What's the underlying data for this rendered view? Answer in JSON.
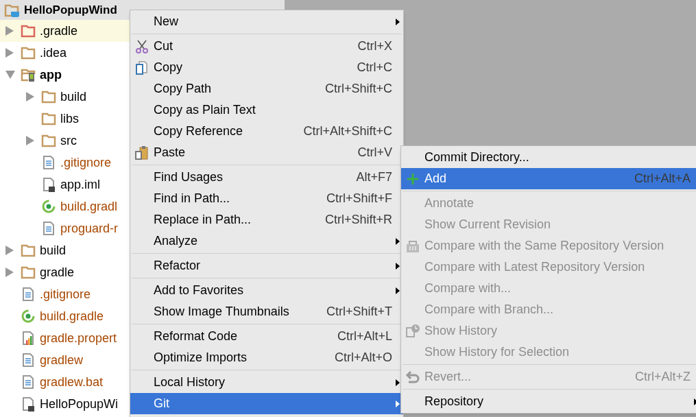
{
  "project_header": {
    "name": "HelloPopupWind"
  },
  "tree": [
    {
      "label": ".gradle",
      "kind": "excluded-folder",
      "expanded": false,
      "highlighted": true,
      "changed": false,
      "bold": false
    },
    {
      "label": ".idea",
      "kind": "folder",
      "expanded": false,
      "highlighted": false,
      "changed": false,
      "bold": false
    },
    {
      "label": "app",
      "kind": "module",
      "expanded": true,
      "highlighted": false,
      "changed": false,
      "bold": true,
      "children": [
        {
          "label": "build",
          "kind": "folder",
          "expanded": false,
          "highlighted": false,
          "changed": false,
          "bold": false
        },
        {
          "label": "libs",
          "kind": "folder",
          "highlighted": false,
          "changed": false,
          "bold": false
        },
        {
          "label": "src",
          "kind": "folder",
          "expanded": false,
          "highlighted": false,
          "changed": false,
          "bold": false
        },
        {
          "label": ".gitignore",
          "kind": "text",
          "highlighted": false,
          "changed": true,
          "bold": false
        },
        {
          "label": "app.iml",
          "kind": "iml",
          "highlighted": false,
          "changed": false,
          "bold": false
        },
        {
          "label": "build.gradl",
          "kind": "gradle",
          "highlighted": false,
          "changed": true,
          "bold": false
        },
        {
          "label": "proguard-r",
          "kind": "text",
          "highlighted": false,
          "changed": true,
          "bold": false
        }
      ]
    },
    {
      "label": "build",
      "kind": "folder",
      "expanded": false,
      "highlighted": false,
      "changed": false,
      "bold": false
    },
    {
      "label": "gradle",
      "kind": "folder",
      "expanded": false,
      "highlighted": false,
      "changed": false,
      "bold": false
    },
    {
      "label": ".gitignore",
      "kind": "text",
      "highlighted": false,
      "changed": true,
      "bold": false
    },
    {
      "label": "build.gradle",
      "kind": "gradle",
      "highlighted": false,
      "changed": true,
      "bold": false
    },
    {
      "label": "gradle.propert",
      "kind": "properties",
      "highlighted": false,
      "changed": true,
      "bold": false
    },
    {
      "label": "gradlew",
      "kind": "text",
      "highlighted": false,
      "changed": true,
      "bold": false
    },
    {
      "label": "gradlew.bat",
      "kind": "text",
      "highlighted": false,
      "changed": true,
      "bold": false
    },
    {
      "label": "HelloPopupWi",
      "kind": "iml",
      "highlighted": false,
      "changed": false,
      "bold": false
    }
  ],
  "context_menu": [
    {
      "kind": "plain",
      "label": "New",
      "submenu": true,
      "selected": false
    },
    {
      "kind": "separator"
    },
    {
      "kind": "cut",
      "label": "Cut",
      "shortcut": "Ctrl+X",
      "submenu": false,
      "selected": false
    },
    {
      "kind": "copy",
      "label": "Copy",
      "shortcut": "Ctrl+C",
      "submenu": false,
      "selected": false
    },
    {
      "kind": "plain",
      "label": "Copy Path",
      "shortcut": "Ctrl+Shift+C",
      "submenu": false,
      "selected": false
    },
    {
      "kind": "plain",
      "label": "Copy as Plain Text",
      "submenu": false,
      "selected": false
    },
    {
      "kind": "plain",
      "label": "Copy Reference",
      "shortcut": "Ctrl+Alt+Shift+C",
      "submenu": false,
      "selected": false
    },
    {
      "kind": "paste",
      "label": "Paste",
      "shortcut": "Ctrl+V",
      "submenu": false,
      "selected": false
    },
    {
      "kind": "separator"
    },
    {
      "kind": "plain",
      "label": "Find Usages",
      "shortcut": "Alt+F7",
      "submenu": false,
      "selected": false
    },
    {
      "kind": "plain",
      "label": "Find in Path...",
      "shortcut": "Ctrl+Shift+F",
      "submenu": false,
      "selected": false
    },
    {
      "kind": "plain",
      "label": "Replace in Path...",
      "shortcut": "Ctrl+Shift+R",
      "submenu": false,
      "selected": false
    },
    {
      "kind": "plain",
      "label": "Analyze",
      "submenu": true,
      "selected": false
    },
    {
      "kind": "separator"
    },
    {
      "kind": "plain",
      "label": "Refactor",
      "submenu": true,
      "selected": false
    },
    {
      "kind": "separator"
    },
    {
      "kind": "plain",
      "label": "Add to Favorites",
      "submenu": true,
      "selected": false
    },
    {
      "kind": "plain",
      "label": "Show Image Thumbnails",
      "shortcut": "Ctrl+Shift+T",
      "submenu": false,
      "selected": false
    },
    {
      "kind": "separator"
    },
    {
      "kind": "plain",
      "label": "Reformat Code",
      "shortcut": "Ctrl+Alt+L",
      "submenu": false,
      "selected": false
    },
    {
      "kind": "plain",
      "label": "Optimize Imports",
      "shortcut": "Ctrl+Alt+O",
      "submenu": false,
      "selected": false
    },
    {
      "kind": "separator"
    },
    {
      "kind": "plain",
      "label": "Local History",
      "submenu": true,
      "selected": false
    },
    {
      "kind": "plain",
      "label": "Git",
      "submenu": true,
      "selected": true
    }
  ],
  "git_submenu": [
    {
      "kind": "plain",
      "label": "Commit Directory...",
      "submenu": false,
      "selected": false,
      "disabled": false
    },
    {
      "kind": "add",
      "label": "Add",
      "shortcut": "Ctrl+Alt+A",
      "submenu": false,
      "selected": true,
      "disabled": false
    },
    {
      "kind": "separator"
    },
    {
      "kind": "plain",
      "label": "Annotate",
      "submenu": false,
      "selected": false,
      "disabled": true
    },
    {
      "kind": "plain",
      "label": "Show Current Revision",
      "submenu": false,
      "selected": false,
      "disabled": true
    },
    {
      "kind": "compare",
      "label": "Compare with the Same Repository Version",
      "submenu": false,
      "selected": false,
      "disabled": true
    },
    {
      "kind": "plain",
      "label": "Compare with Latest Repository Version",
      "submenu": false,
      "selected": false,
      "disabled": true
    },
    {
      "kind": "plain",
      "label": "Compare with...",
      "submenu": false,
      "selected": false,
      "disabled": true
    },
    {
      "kind": "plain",
      "label": "Compare with Branch...",
      "submenu": false,
      "selected": false,
      "disabled": true
    },
    {
      "kind": "history",
      "label": "Show History",
      "submenu": false,
      "selected": false,
      "disabled": true
    },
    {
      "kind": "plain",
      "label": "Show History for Selection",
      "submenu": false,
      "selected": false,
      "disabled": true
    },
    {
      "kind": "separator"
    },
    {
      "kind": "revert",
      "label": "Revert...",
      "shortcut": "Ctrl+Alt+Z",
      "submenu": false,
      "selected": false,
      "disabled": true
    },
    {
      "kind": "separator"
    },
    {
      "kind": "plain",
      "label": "Repository",
      "submenu": true,
      "selected": false,
      "disabled": false
    }
  ]
}
